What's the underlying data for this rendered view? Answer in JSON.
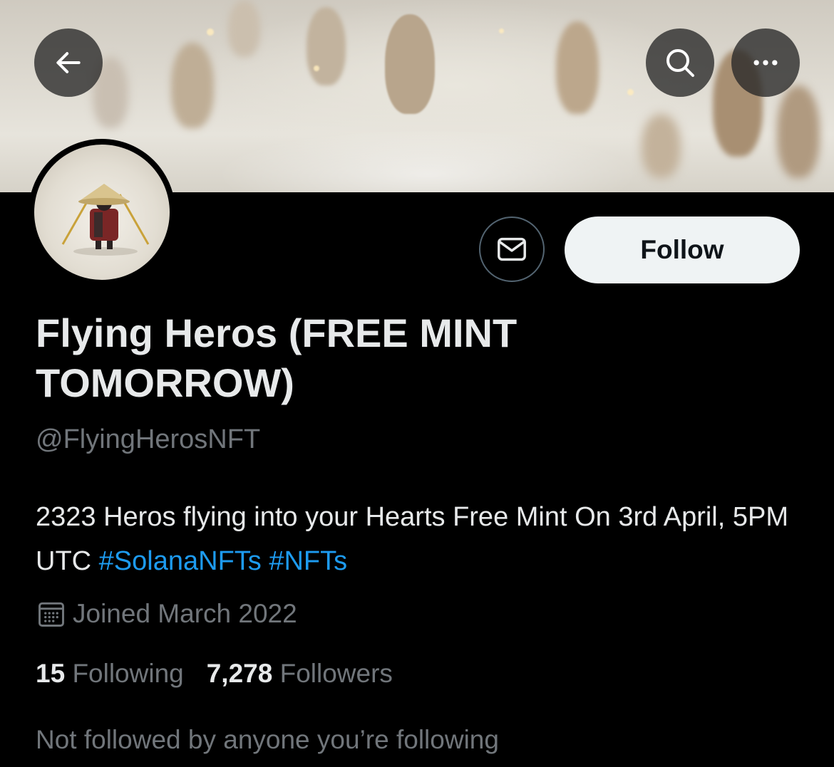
{
  "header": {
    "back_icon": "arrow-left-icon",
    "search_icon": "search-icon",
    "more_icon": "more-horizontal-icon"
  },
  "profile": {
    "display_name": "Flying Heros (FREE MINT TOMORROW)",
    "handle": "@FlyingHerosNFT",
    "bio_text": "2323 Heros flying into your Hearts Free Mint On 3rd April, 5PM UTC",
    "bio_hashtags": [
      "#SolanaNFTs",
      "#NFTs"
    ],
    "joined": "Joined March 2022",
    "joined_icon": "calendar-icon",
    "following_count": "15",
    "following_label": "Following",
    "followers_count": "7,278",
    "followers_label": "Followers",
    "mutual_followers": "Not followed by anyone you’re following"
  },
  "actions": {
    "message_icon": "envelope-icon",
    "follow_label": "Follow"
  },
  "colors": {
    "background": "#000000",
    "text_primary": "#e7e9ea",
    "text_secondary": "#71767b",
    "link": "#1d9bf0",
    "follow_bg": "#eff3f4"
  }
}
